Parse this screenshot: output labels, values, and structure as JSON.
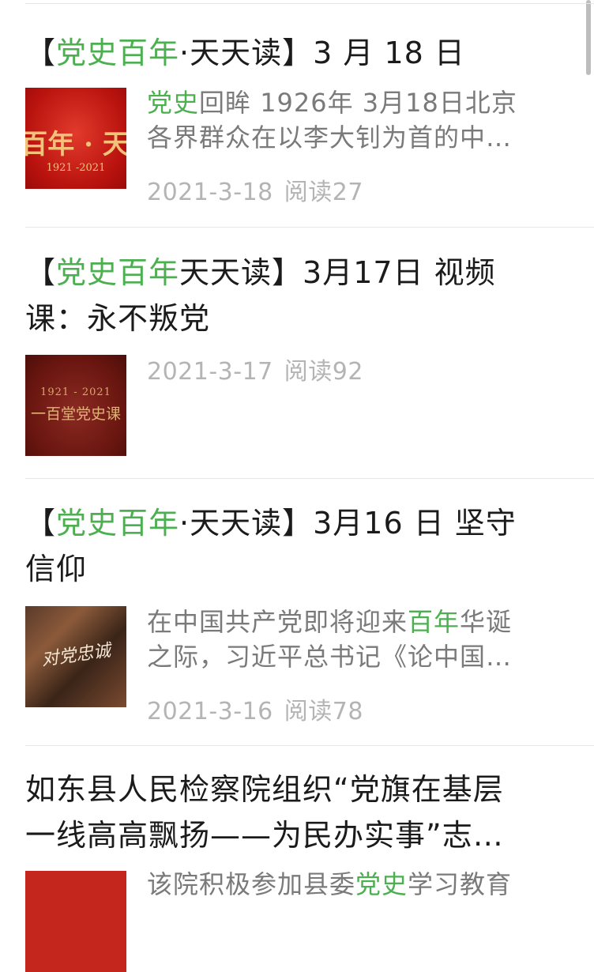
{
  "articles": [
    {
      "title_pre": "【",
      "title_hl": "党史百年",
      "title_post": "·天天读】3 月 18 日",
      "summary_hl": "党史",
      "summary_line1_rest": "回眸 1926年 3月18日北京",
      "summary_line2": "各界群众在以李大钊为首的中…",
      "date": "2021-3-18",
      "reads": "阅读27",
      "thumb_text": "百年 · 天",
      "thumb_sub": "1921 -2021"
    },
    {
      "title_pre": "【",
      "title_hl": "党史百年",
      "title_post": "天天读】3月17日 视频",
      "title_line2": "课：永不叛党",
      "date": "2021-3-17",
      "reads": "阅读92",
      "thumb_top": "1921 - 2021",
      "thumb_text": "一百堂党史课"
    },
    {
      "title_pre": "【",
      "title_hl": "党史百年",
      "title_post": "·天天读】3月16 日 坚守",
      "title_line2": "信仰",
      "summary_pre": "在中国共产党即将迎来",
      "summary_hl": "百年",
      "summary_post": "华诞",
      "summary_line2": "之际，习近平总书记《论中国…",
      "date": "2021-3-16",
      "reads": "阅读78",
      "thumb_text": "对党忠诚"
    },
    {
      "title_line1": "如东县人民检察院组织“党旗在基层",
      "title_line2": "一线高高飘扬——为民办实事”志…",
      "summary_pre": "该院积极参加县委",
      "summary_hl": "党史",
      "summary_post": "学习教育"
    }
  ]
}
